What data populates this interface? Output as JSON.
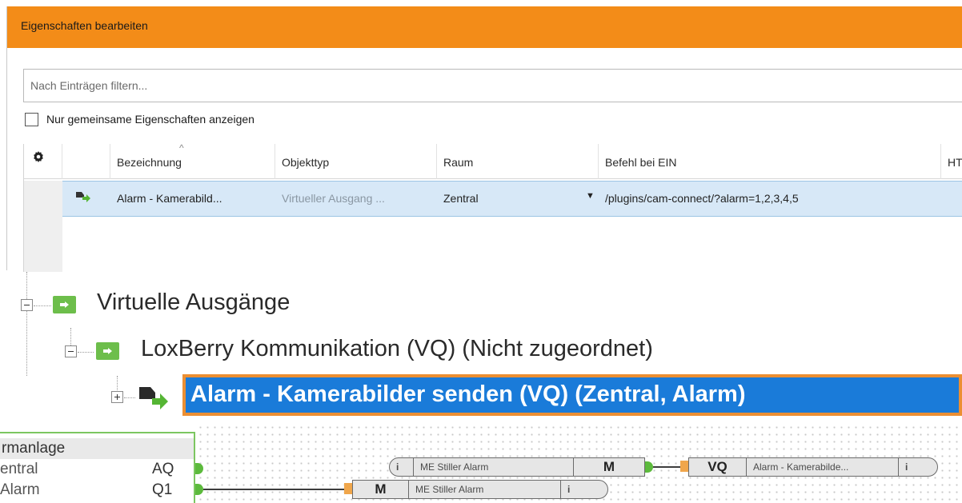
{
  "dialog": {
    "title": "Eigenschaften bearbeiten",
    "filter_placeholder": "Nach Einträgen filtern...",
    "checkbox_label": "Nur gemeinsame Eigenschaften anzeigen",
    "columns": [
      "Bezeichnung",
      "Objekttyp",
      "Raum",
      "Befehl bei EIN",
      "HT"
    ],
    "row": {
      "name": "Alarm - Kamerabild...",
      "type": "Virtueller Ausgang ...",
      "room": "Zentral",
      "command": "/plugins/cam-connect/?alarm=1,2,3,4,5"
    }
  },
  "tree": {
    "level1": "Virtuelle Ausgänge",
    "level2": "LoxBerry Kommunikation (VQ) (Nicht zugeordnet)",
    "selected": "Alarm - Kamerabilder senden (VQ) (Zentral, Alarm)"
  },
  "diagram": {
    "block_title": "rmanlage",
    "inputs": [
      {
        "label": "entral",
        "output": "AQ"
      },
      {
        "label": "Alarm",
        "output": "Q1"
      }
    ],
    "memory1": {
      "info": "i",
      "label": "ME Stiller Alarm",
      "type": "M"
    },
    "memory2": {
      "type": "M",
      "label": "ME Stiller Alarm",
      "info": "i"
    },
    "vq": {
      "type": "VQ",
      "label": "Alarm - Kamerabilde...",
      "info": "i"
    }
  },
  "colors": {
    "titlebar": "#f38c18",
    "selection_fill": "#1a7bd9",
    "selection_border": "#ec8f33",
    "folder_green": "#6dbe4b",
    "row_highlight": "#d7e8f7"
  },
  "icons": [
    "gear-icon",
    "virtual-output-icon",
    "folder-icon",
    "collapse-icon",
    "expand-icon",
    "dropdown-arrow-icon"
  ]
}
